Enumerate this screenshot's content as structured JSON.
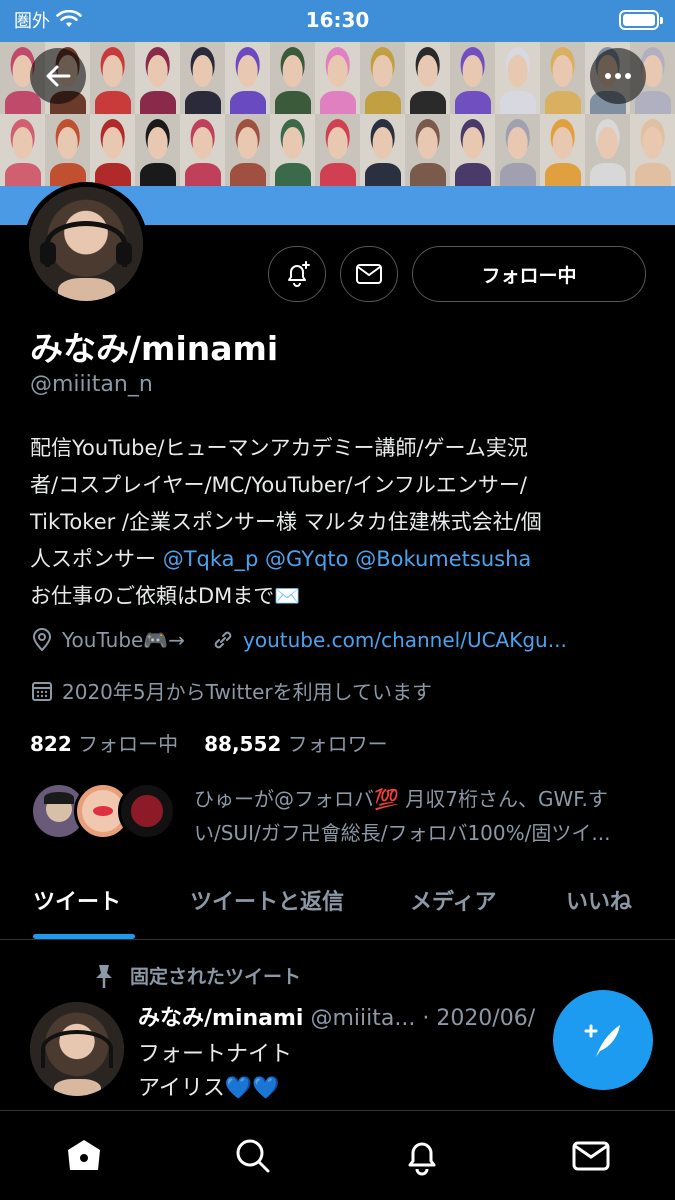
{
  "status_bar": {
    "carrier": "圏外",
    "time": "16:30"
  },
  "banner": {
    "colors": [
      "#c04a6a",
      "#6a3a2a",
      "#c93a3a",
      "#8a2a4a",
      "#2a2a3a",
      "#6a4ac0",
      "#3a5a3a",
      "#e080c0",
      "#c0a040",
      "#2a2a2a",
      "#7050c0",
      "#d8d8e0",
      "#d8b060",
      "#8090a0",
      "#b0b0c0",
      "#d06070",
      "#c05030",
      "#b02a2a",
      "#1a1a1a",
      "#c0405a",
      "#a05040",
      "#3a6a4a",
      "#d04050",
      "#2a3040",
      "#7a5a4a",
      "#4a3a6a",
      "#a0a0b0",
      "#e0a040",
      "#d8d8d8",
      "#e0c0a0"
    ],
    "accent": "#3e8fd8"
  },
  "profile": {
    "name": "みなみ/minami",
    "handle": "@miiitan_n",
    "follow_button": "フォロー中",
    "bio": {
      "line1": "配信YouTube/ヒューマンアカデミー講師/ゲーム実況",
      "line2": "者/コスプレイヤー/MC/YouTuber/インフルエンサー/",
      "line3": "TikToker /企業スポンサー様 マルタカ住建株式会社/個",
      "line4_prefix": "人スポンサー ",
      "mention1": "@Tqka_p",
      "mention2": "@GYqto",
      "mention3": "@Bokumetsusha",
      "line5": "お仕事のご依頼はDMまで✉️"
    },
    "location": "YouTube🎮→",
    "link": "youtube.com/channel/UCAKgu...",
    "joined": "2020年5月からTwitterを利用しています",
    "following_count": "822",
    "following_label": "フォロー中",
    "followers_count": "88,552",
    "followers_label": "フォロワー",
    "followed_by": "ひゅーが@フォロバ💯 月収7桁さん、GWF.すい/SUI/ガフ卍會総長/フォロバ100%/固ツイ..."
  },
  "tabs": [
    "ツイート",
    "ツイートと返信",
    "メディア",
    "いいね"
  ],
  "tweet": {
    "pinned_label": "固定されたツイート",
    "author_name": "みなみ/minami",
    "author_handle_date": "@miiita... · 2020/06/",
    "line1": "フォートナイト",
    "line2": "アイリス💙💙"
  },
  "icons": {
    "back": "back-arrow-icon",
    "more": "more-icon",
    "bell": "bell-plus-icon",
    "mail": "mail-icon",
    "location": "location-pin-icon",
    "link": "link-icon",
    "calendar": "calendar-icon",
    "pin": "pin-icon",
    "compose": "compose-icon",
    "home": "home-icon",
    "search": "search-icon",
    "notifications": "bell-icon",
    "messages": "mail-icon"
  }
}
